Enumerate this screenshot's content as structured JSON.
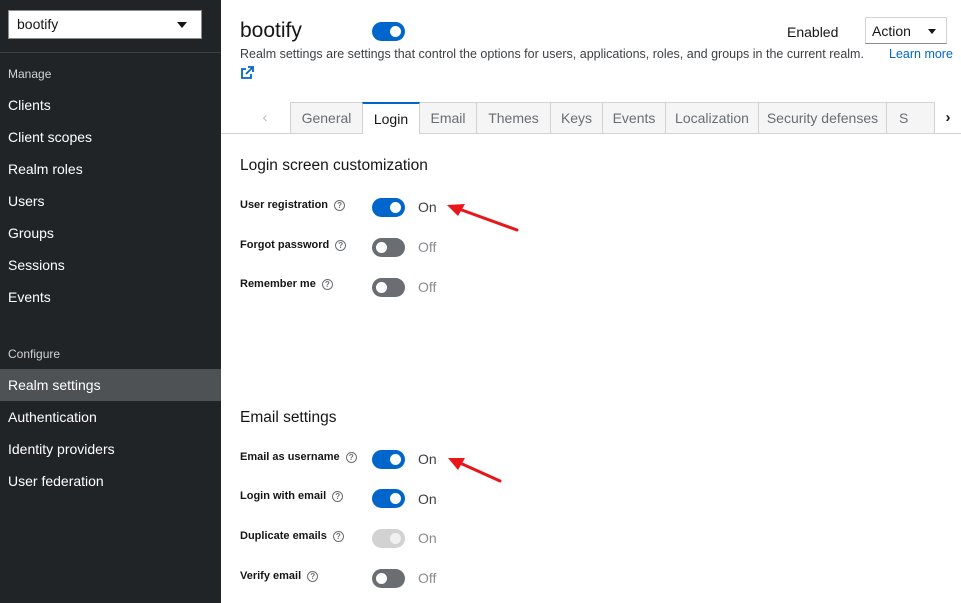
{
  "sidebar": {
    "realm_selector": "bootify",
    "groups": [
      {
        "title": "Manage",
        "items": [
          "Clients",
          "Client scopes",
          "Realm roles",
          "Users",
          "Groups",
          "Sessions",
          "Events"
        ]
      },
      {
        "title": "Configure",
        "items": [
          "Realm settings",
          "Authentication",
          "Identity providers",
          "User federation"
        ]
      }
    ],
    "active_item": "Realm settings"
  },
  "header": {
    "title": "bootify",
    "enabled_label": "Enabled",
    "action_label": "Action",
    "description": "Realm settings are settings that control the options for users, applications, roles, and groups in the current realm.",
    "learn_more": "Learn more"
  },
  "tabs": [
    "General",
    "Login",
    "Email",
    "Themes",
    "Keys",
    "Events",
    "Localization",
    "Security defenses",
    "S"
  ],
  "active_tab": "Login",
  "sections": [
    {
      "title": "Login screen customization",
      "fields": [
        {
          "label": "User registration",
          "state": "On"
        },
        {
          "label": "Forgot password",
          "state": "Off"
        },
        {
          "label": "Remember me",
          "state": "Off"
        }
      ]
    },
    {
      "title": "Email settings",
      "fields": [
        {
          "label": "Email as username",
          "state": "On"
        },
        {
          "label": "Login with email",
          "state": "On"
        },
        {
          "label": "Duplicate emails",
          "state": "On"
        },
        {
          "label": "Verify email",
          "state": "Off"
        }
      ]
    }
  ],
  "icons": {
    "help": "help-circle-icon",
    "external_link": "external-link-icon",
    "annotation": "red-arrow-icon"
  },
  "colors": {
    "accent": "#0066cc",
    "sidebar_bg": "#212427",
    "annotation": "#e8161a"
  }
}
